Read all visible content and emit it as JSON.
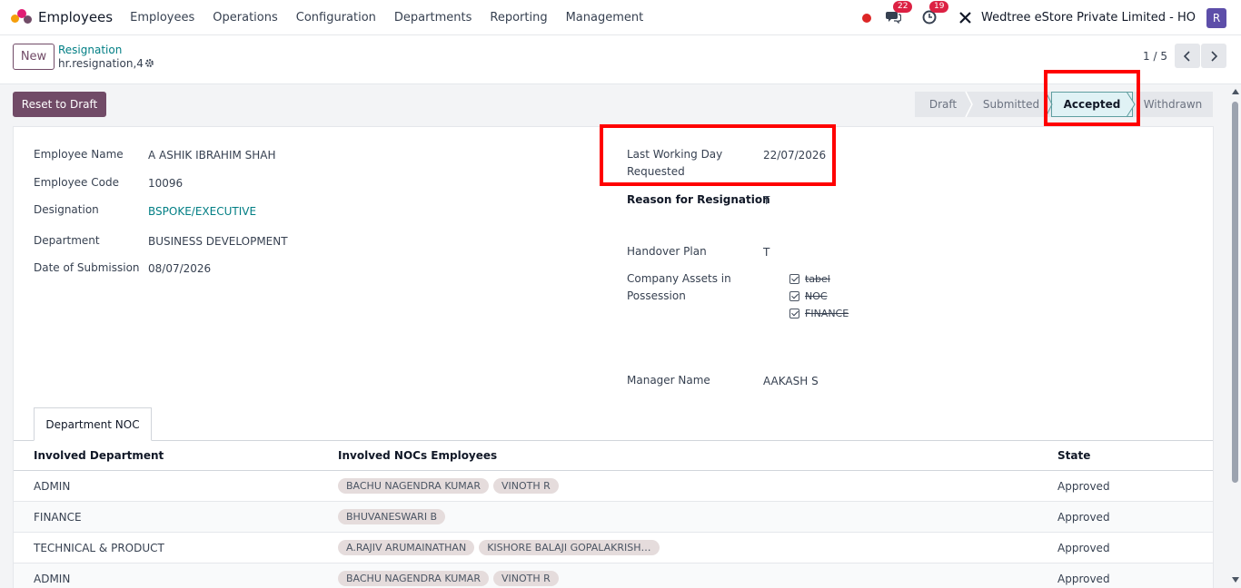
{
  "navbar": {
    "app_name": "Employees",
    "menu": [
      "Employees",
      "Operations",
      "Configuration",
      "Departments",
      "Reporting",
      "Management"
    ],
    "messages_count": "22",
    "activities_count": "19",
    "company": "Wedtree eStore Private Limited - HO",
    "user_initial": "R"
  },
  "control": {
    "new_label": "New",
    "breadcrumb_parent": "Resignation",
    "record_name": "hr.resignation,4",
    "pager": "1 / 5"
  },
  "actions": {
    "reset_label": "Reset to Draft"
  },
  "statusbar": [
    "Draft",
    "Submitted",
    "Accepted",
    "Withdrawn"
  ],
  "status_active": "Accepted",
  "left_fields": [
    {
      "label": "Employee Name",
      "value": "A ASHIK IBRAHIM SHAH"
    },
    {
      "label": "Employee Code",
      "value": "10096"
    },
    {
      "label": "Designation",
      "value": "BSPOKE/EXECUTIVE"
    },
    {
      "label": "Department",
      "value": "BUSINESS DEVELOPMENT"
    },
    {
      "label": "Date of Submission",
      "value": "08/07/2026"
    }
  ],
  "right_fields": {
    "last_day_label_1": "Last Working Day",
    "last_day_label_2": "Requested",
    "last_day_value": "22/07/2026",
    "reason_label": "Reason for Resignation",
    "reason_value": "T",
    "handover_label": "Handover Plan",
    "handover_value": "T",
    "assets_label_1": "Company Assets in",
    "assets_label_2": "Possession",
    "assets": [
      "tabel",
      "NOC",
      "FINANCE"
    ],
    "manager_label": "Manager Name",
    "manager_value": "AAKASH S"
  },
  "notebook": {
    "tab": "Department NOC",
    "columns": [
      "Involved Department",
      "Involved NOCs Employees",
      "State"
    ],
    "rows": [
      {
        "department": "ADMIN",
        "employees": [
          "BACHU NAGENDRA KUMAR",
          "VINOTH R"
        ],
        "state": "Approved"
      },
      {
        "department": "FINANCE",
        "employees": [
          "BHUVANESWARI B"
        ],
        "state": "Approved"
      },
      {
        "department": "TECHNICAL & PRODUCT",
        "employees": [
          "A.RAJIV ARUMAINATHAN",
          "KISHORE BALAJI GOPALAKRISH…"
        ],
        "state": "Approved"
      },
      {
        "department": "ADMIN",
        "employees": [
          "BACHU NAGENDRA KUMAR",
          "VINOTH R"
        ],
        "state": "Approved"
      }
    ]
  }
}
